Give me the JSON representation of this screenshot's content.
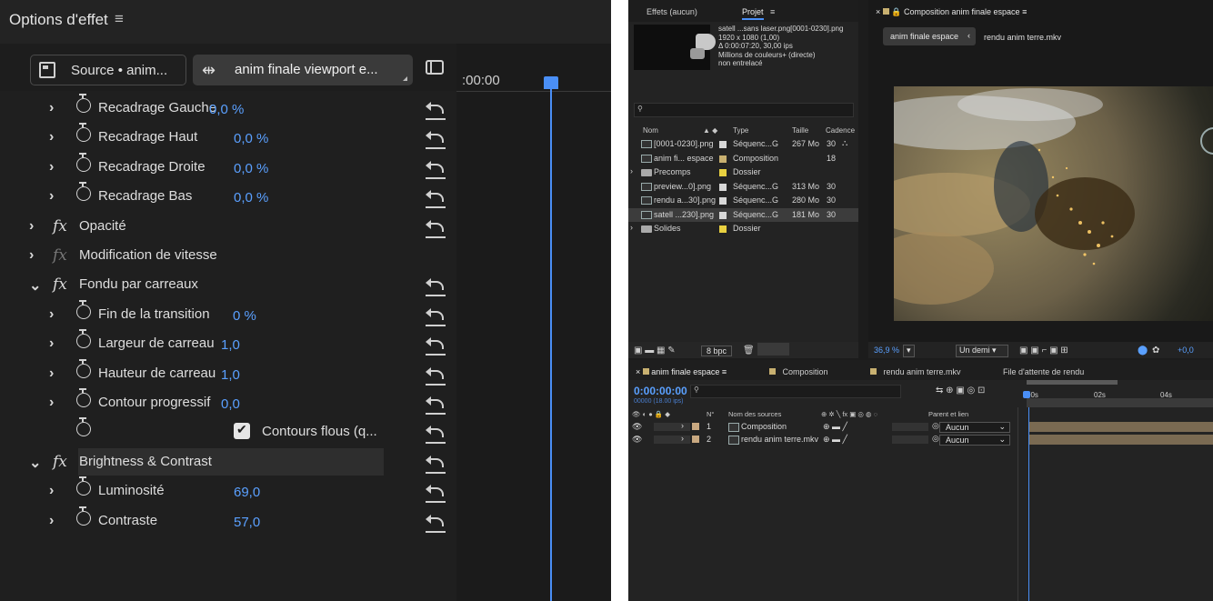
{
  "effect_controls": {
    "title": "Options d'effet",
    "source_tab": "Source • anim...",
    "sequence_tab": "anim finale viewport e...",
    "timecode": ":00:00",
    "rows": [
      {
        "kind": "param",
        "label": "Recadrage Gauche",
        "value": "0,0 %"
      },
      {
        "kind": "param",
        "label": "Recadrage Haut",
        "value": "0,0 %"
      },
      {
        "kind": "param",
        "label": "Recadrage Droite",
        "value": "0,0 %"
      },
      {
        "kind": "param",
        "label": "Recadrage Bas",
        "value": "0,0 %"
      },
      {
        "kind": "effect",
        "label": "Opacité"
      },
      {
        "kind": "effect-dim",
        "label": "Modification de vitesse"
      },
      {
        "kind": "effect-open",
        "label": "Fondu par carreaux"
      },
      {
        "kind": "param",
        "label": "Fin de la transition",
        "value": "0 %"
      },
      {
        "kind": "param",
        "label": "Largeur de carreau",
        "value": "1,0"
      },
      {
        "kind": "param",
        "label": "Hauteur de carreau",
        "value": "1,0"
      },
      {
        "kind": "param",
        "label": "Contour progressif",
        "value": "0,0"
      },
      {
        "kind": "checkbox",
        "label": "Contours flous (q..."
      },
      {
        "kind": "effect-open-hl",
        "label": "Brightness & Contrast"
      },
      {
        "kind": "param",
        "label": "Luminosité",
        "value": "69,0"
      },
      {
        "kind": "param",
        "label": "Contraste",
        "value": "57,0"
      }
    ]
  },
  "project": {
    "tabs": [
      "Effets (aucun)",
      "Projet"
    ],
    "info_name": "satell ...sans laser.png[0001-0230].png",
    "info_lines": [
      "1920 x 1080 (1,00)",
      "Δ 0:00:07:20, 30,00 ips",
      "Millions de couleurs+ (directe)",
      "non entrelacé"
    ],
    "columns": {
      "name": "Nom",
      "type": "Type",
      "size": "Taille",
      "rate": "Cadence"
    },
    "items": [
      {
        "name": "[0001-0230].png",
        "type": "Séquenc...G",
        "size": "267 Mo",
        "rate": "30",
        "icon": "file",
        "color": "#d8d8d8"
      },
      {
        "name": "anim fi... espace",
        "type": "Composition",
        "size": "",
        "rate": "18",
        "icon": "comp",
        "color": "#c8b070"
      },
      {
        "name": "Precomps",
        "type": "Dossier",
        "size": "",
        "rate": "",
        "icon": "folder",
        "color": "#e8d040"
      },
      {
        "name": "preview...0].png",
        "type": "Séquenc...G",
        "size": "313 Mo",
        "rate": "30",
        "icon": "file",
        "color": "#d8d8d8"
      },
      {
        "name": "rendu a...30].png",
        "type": "Séquenc...G",
        "size": "280 Mo",
        "rate": "30",
        "icon": "file",
        "color": "#d8d8d8"
      },
      {
        "name": "satell ...230].png",
        "type": "Séquenc...G",
        "size": "181 Mo",
        "rate": "30",
        "icon": "file",
        "color": "#d8d8d8",
        "selected": true
      },
      {
        "name": "Solides",
        "type": "Dossier",
        "size": "",
        "rate": "",
        "icon": "folder",
        "color": "#e8d040"
      }
    ],
    "bpc": "8 bpc"
  },
  "composition": {
    "tab_label": "Composition anim finale espace",
    "breadcrumb_active": "anim finale espace",
    "breadcrumb_next": "rendu anim terre.mkv",
    "zoom": "36,9 %",
    "resolution": "Un demi",
    "exposure": "+0,0"
  },
  "timeline": {
    "tabs": [
      "anim finale espace",
      "Composition",
      "rendu anim terre.mkv",
      "File d'attente de rendu"
    ],
    "timecode": "0:00:00:00",
    "frames": "00000 (18.00 ips)",
    "ruler": [
      "00s",
      "02s",
      "04s"
    ],
    "headers": {
      "num": "N°",
      "name": "Nom des sources",
      "parent": "Parent et lien"
    },
    "layers": [
      {
        "num": "1",
        "name": "Composition",
        "parent": "Aucun"
      },
      {
        "num": "2",
        "name": "rendu anim terre.mkv",
        "parent": "Aucun"
      }
    ]
  }
}
